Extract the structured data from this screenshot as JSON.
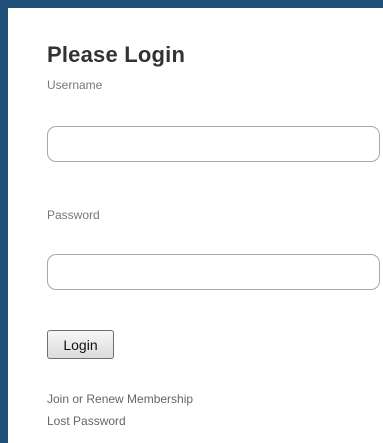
{
  "login": {
    "title": "Please Login",
    "username_label": "Username",
    "username_value": "",
    "username_placeholder": "",
    "password_label": "Password",
    "password_value": "",
    "password_placeholder": "",
    "login_button_label": "Login",
    "links": {
      "join_renew": "Join or Renew Membership",
      "lost_password": "Lost Password"
    }
  },
  "colors": {
    "frame_border": "#1f4e79",
    "title_text": "#333333",
    "label_text": "#777777",
    "link_text": "#666666"
  }
}
